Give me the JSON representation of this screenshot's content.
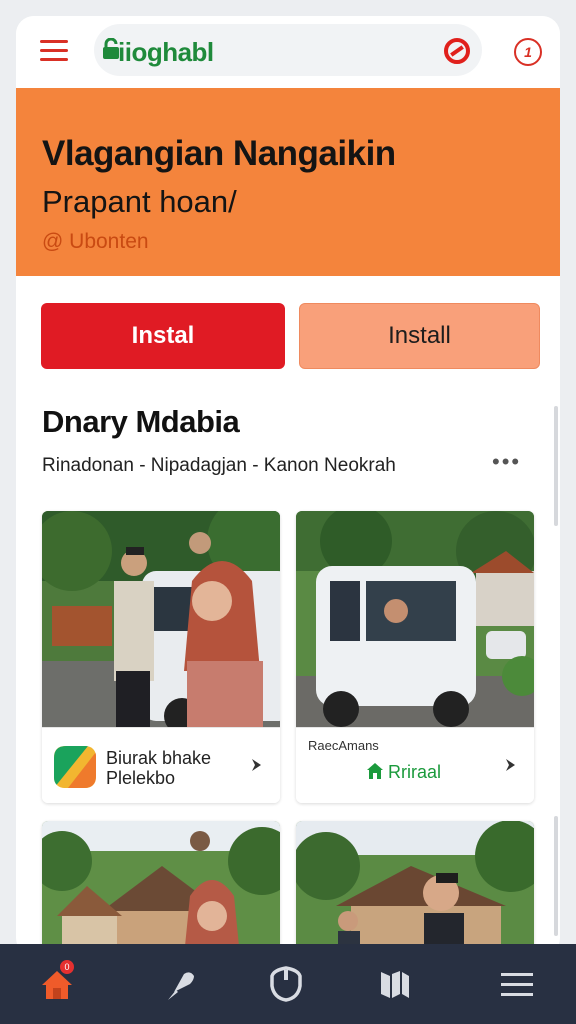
{
  "header": {
    "brand": "iioghabl",
    "icons": [
      "menu-icon",
      "lock-icon",
      "no-entry-icon",
      "clock-icon"
    ],
    "clock_glyph": "1"
  },
  "hero": {
    "title": "Vlagangian Nangaikin",
    "subtitle": "Prapant hoan/",
    "author": "@ Ubonten",
    "background": "#f4843c"
  },
  "actions": {
    "primary_label": "Instal",
    "secondary_label": "Install",
    "primary_color": "#e01b24",
    "secondary_color": "#f9a07a"
  },
  "section": {
    "title": "Dnary Mdabia",
    "subtitle": "Rinadonan - Nipadagjan - Kanon Neokrah",
    "more_icon": "more-horizontal-icon"
  },
  "tiles": [
    {
      "line1": "Biurak bhake",
      "line2": "Plelekbo",
      "icon": "app-badge-icon"
    },
    {
      "title": "RaecAmans",
      "link": "Rriraal",
      "icon": "home-green-icon"
    },
    {},
    {}
  ],
  "bottom_nav": {
    "items": [
      "home-icon",
      "pin-icon",
      "shield-icon",
      "map-icon",
      "menu-icon"
    ],
    "home_badge": "0"
  }
}
